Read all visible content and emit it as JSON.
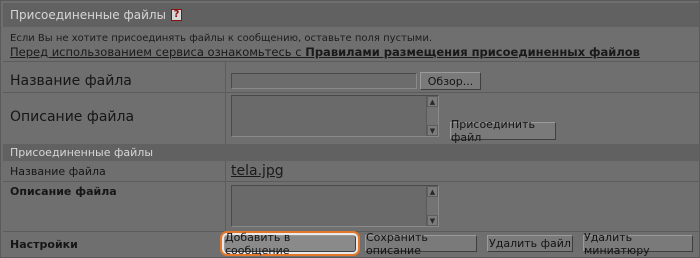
{
  "header": {
    "title": "Присоединенные файлы",
    "help_icon": "?"
  },
  "info": {
    "hint": "Если Вы не хотите присоединять файлы к сообщению, оставьте поля пустыми.",
    "rules_prefix": "Перед использованием сервиса ознакомьтесь с ",
    "rules_link": "Правилами размещения присоединенных файлов"
  },
  "upload": {
    "file_name_label": "Название файла",
    "file_name_value": "",
    "browse_button": "Обзор...",
    "description_label": "Описание файла",
    "description_value": "",
    "attach_button": "Присоединить файл"
  },
  "attached": {
    "section_title": "Присоединенные файлы",
    "file_name_label": "Название файла",
    "file_name": "tela.jpg",
    "description_label": "Описание файла",
    "description_value": "",
    "settings_label": "Настройки",
    "buttons": {
      "add_to_message": "Добавить в сообщение",
      "save_description": "Сохранить описание",
      "delete_file": "Удалить файл",
      "delete_thumbnail": "Удалить миниатюру"
    }
  },
  "colors": {
    "highlight_ring": "#e2762b"
  }
}
